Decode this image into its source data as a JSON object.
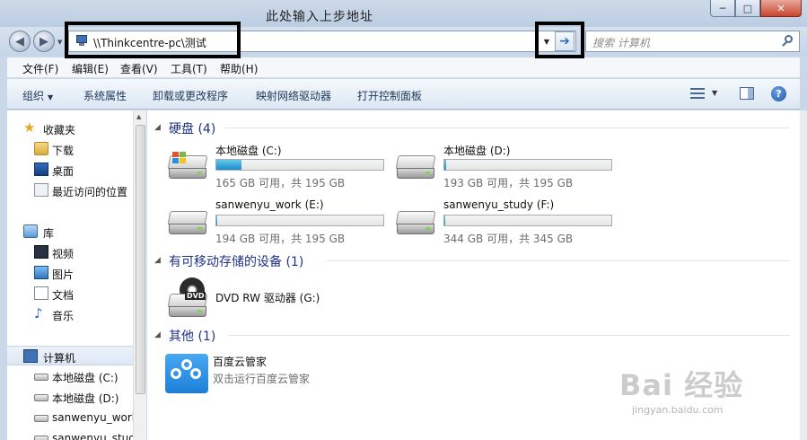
{
  "window": {
    "title": "此处输入上步地址",
    "controls": {
      "minimize": "─",
      "maximize": "□",
      "close": "✕"
    }
  },
  "address": {
    "path": "\\\\Thinkcentre-pc\\测试",
    "go_glyph": "➔",
    "search_placeholder": "搜索 计算机"
  },
  "menu": [
    "文件(F)",
    "编辑(E)",
    "查看(V)",
    "工具(T)",
    "帮助(H)"
  ],
  "toolbar": {
    "organize": "组织",
    "items": [
      "系统属性",
      "卸载或更改程序",
      "映射网络驱动器",
      "打开控制面板"
    ],
    "help_glyph": "?"
  },
  "nav": {
    "favorites": {
      "label": "收藏夹",
      "items": [
        "下载",
        "桌面",
        "最近访问的位置"
      ]
    },
    "libraries": {
      "label": "库",
      "items": [
        "视频",
        "图片",
        "文档",
        "音乐"
      ]
    },
    "computer": {
      "label": "计算机",
      "items": [
        "本地磁盘 (C:)",
        "本地磁盘 (D:)",
        "sanwenyu_work",
        "sanwenyu_study"
      ]
    }
  },
  "groups": {
    "hdd": {
      "title": "硬盘 (4)",
      "drives": [
        {
          "name": "本地磁盘 (C:)",
          "free": "165 GB 可用，共 195 GB",
          "used_fraction": 0.15,
          "system": true
        },
        {
          "name": "本地磁盘 (D:)",
          "free": "193 GB 可用，共 195 GB",
          "used_fraction": 0.01,
          "system": false
        },
        {
          "name": "sanwenyu_work (E:)",
          "free": "194 GB 可用，共 195 GB",
          "used_fraction": 0.005,
          "system": false
        },
        {
          "name": "sanwenyu_study (F:)",
          "free": "344 GB 可用，共 345 GB",
          "used_fraction": 0.003,
          "system": false
        }
      ]
    },
    "removable": {
      "title": "有可移动存储的设备 (1)",
      "devices": [
        {
          "name": "DVD RW 驱动器 (G:)",
          "icon_text": "DVD"
        }
      ]
    },
    "other": {
      "title": "其他 (1)",
      "items": [
        {
          "name": "百度云管家",
          "desc": "双击运行百度云管家"
        }
      ]
    }
  },
  "watermark": {
    "main": "Bai 经验",
    "sub": "jingyan.baidu.com"
  },
  "colors": {
    "group_title": "#1e3287",
    "bar_fill": "#1b8cc9",
    "accent": "#2d6bb5"
  }
}
